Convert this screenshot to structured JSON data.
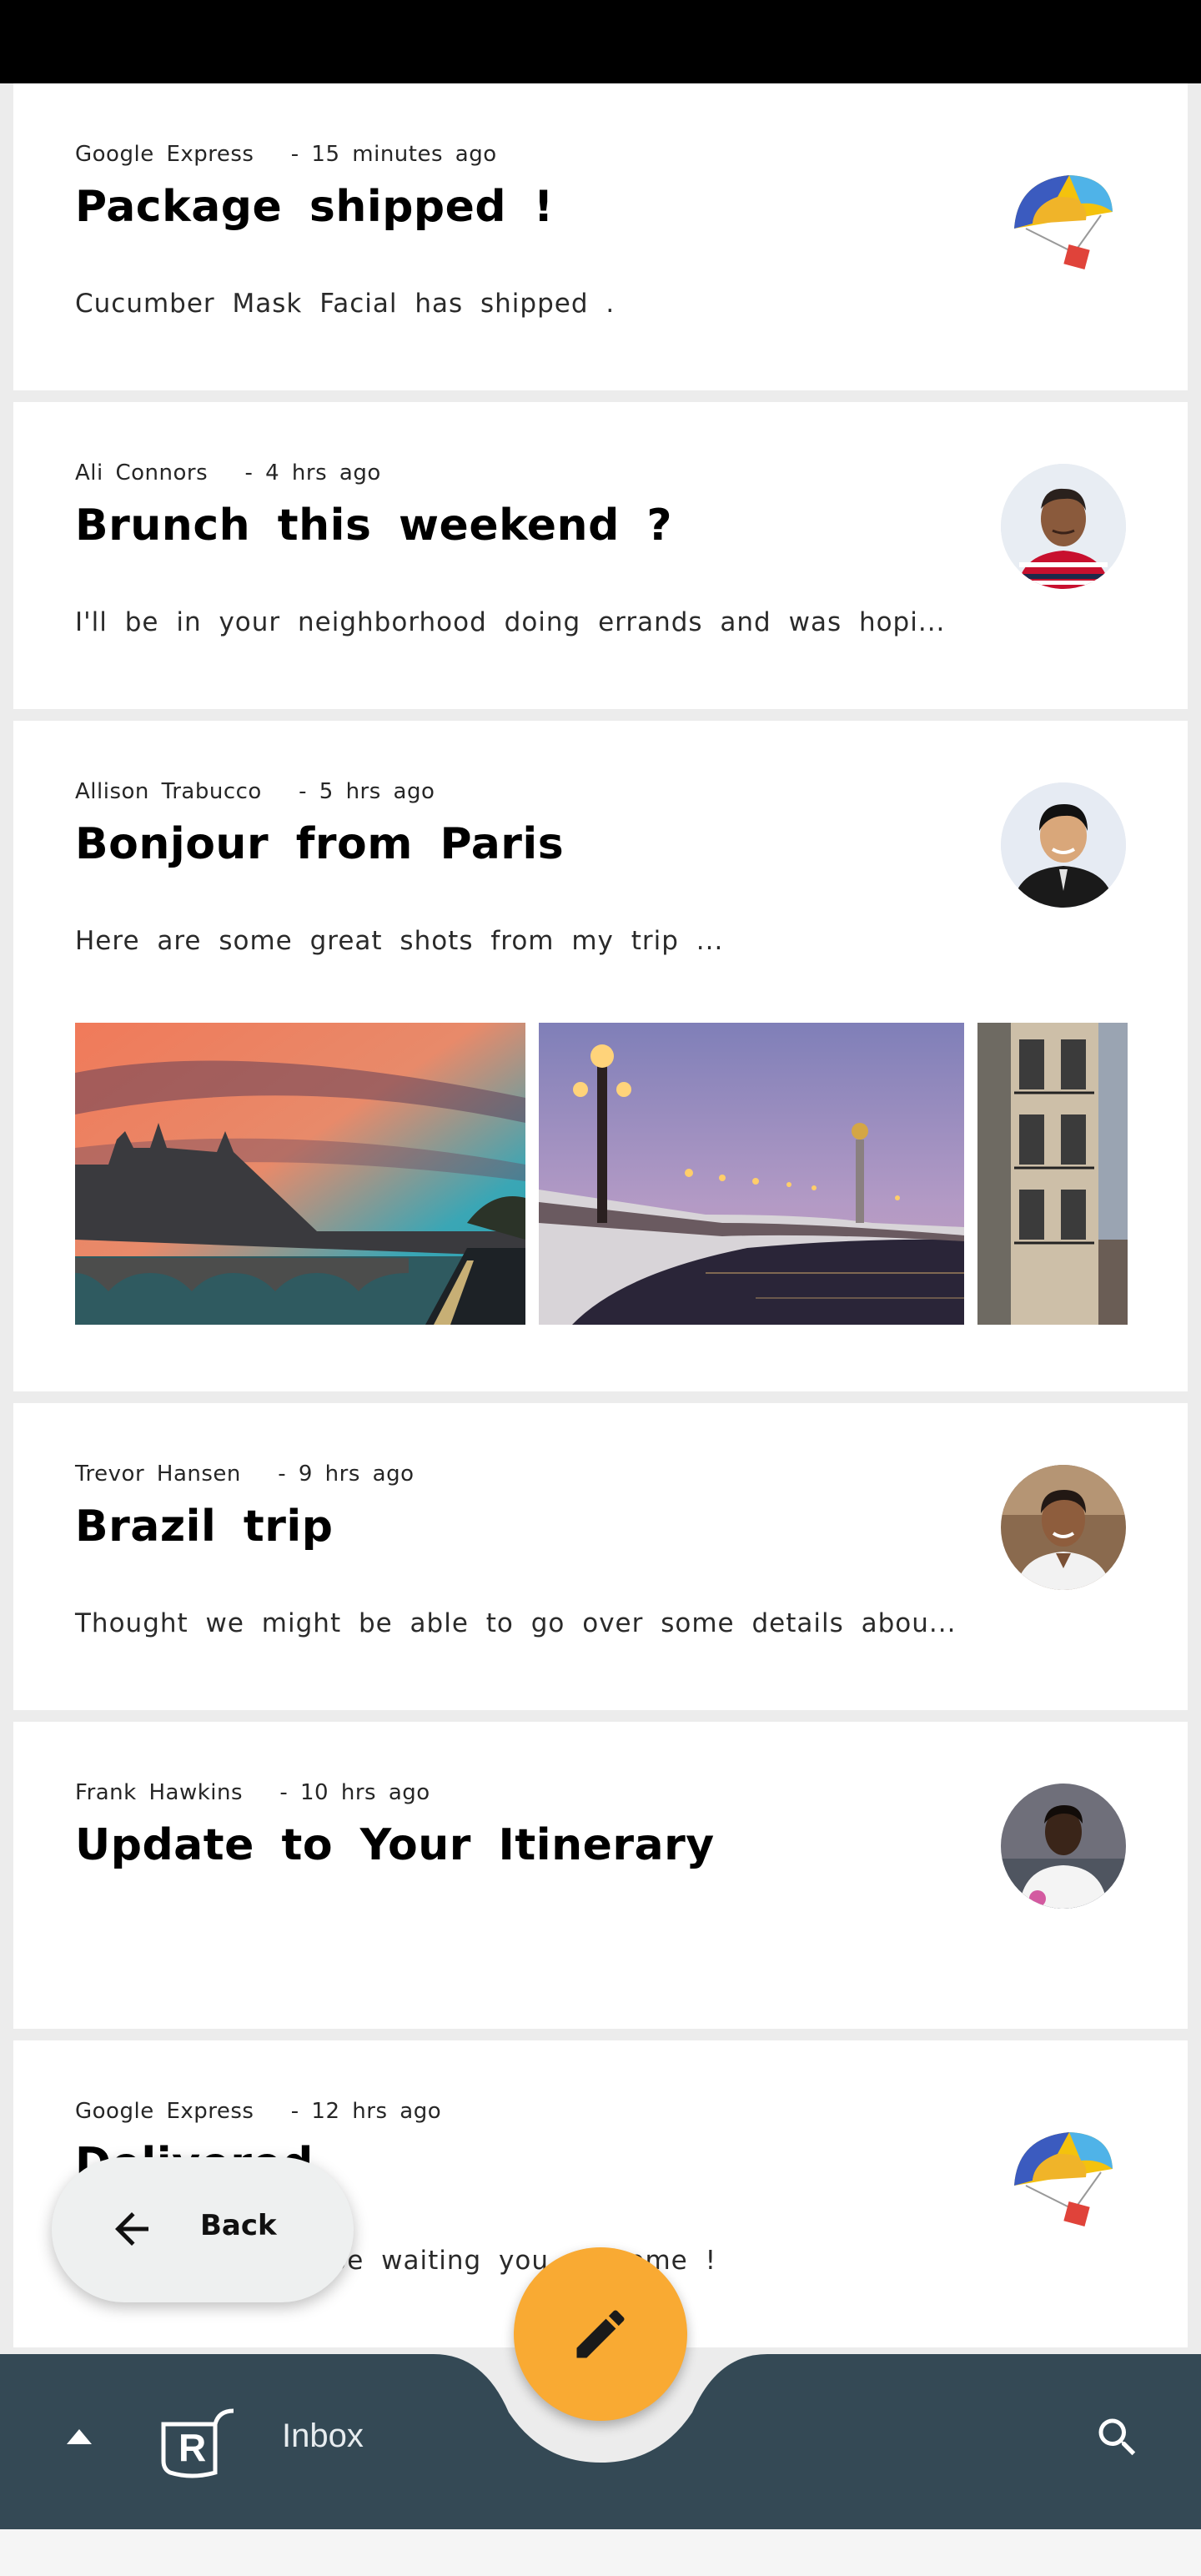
{
  "app": {
    "name": "Reply",
    "colors": {
      "primary": "#344955",
      "accent": "#f9aa33",
      "card": "#ffffff",
      "background": "#ececec"
    }
  },
  "emails": [
    {
      "sender": "Google Express",
      "time": "- 15 minutes ago",
      "subject": "Package shipped !",
      "preview": "Cucumber Mask Facial has shipped .",
      "avatar": "google-express-parachute-icon"
    },
    {
      "sender": "Ali Connors",
      "time": "- 4 hrs ago",
      "subject": "Brunch this weekend ?",
      "preview": "I'll be in your neighborhood doing errands and was hopi...",
      "avatar": "ali-connors-avatar"
    },
    {
      "sender": "Allison Trabucco",
      "time": "- 5 hrs ago",
      "subject": "Bonjour from Paris",
      "preview": "Here are some great shots from my trip ...",
      "avatar": "allison-trabucco-avatar",
      "attachments": [
        "paris-conciergerie-sunset-photo",
        "pont-alexandre-iii-photo",
        "paris-street-building-photo"
      ]
    },
    {
      "sender": "Trevor Hansen",
      "time": "- 9 hrs ago",
      "subject": "Brazil trip",
      "preview": "Thought we might be able to go over some details abou...",
      "avatar": "trevor-hansen-avatar"
    },
    {
      "sender": "Frank Hawkins",
      "time": "- 10 hrs ago",
      "subject": "Update to Your Itinerary",
      "preview": "",
      "avatar": "frank-hawkins-avatar"
    },
    {
      "sender": "Google Express",
      "time": "- 12 hrs ago",
      "subject": "Delivered",
      "preview": "Your shoes should be waiting for you at home !",
      "preview_visible": "d be waiting you at home !",
      "avatar": "google-express-parachute-icon"
    }
  ],
  "back_button": {
    "label": "Back"
  },
  "bottom_bar": {
    "label": "Inbox"
  },
  "fab": {
    "icon": "pencil-icon"
  }
}
